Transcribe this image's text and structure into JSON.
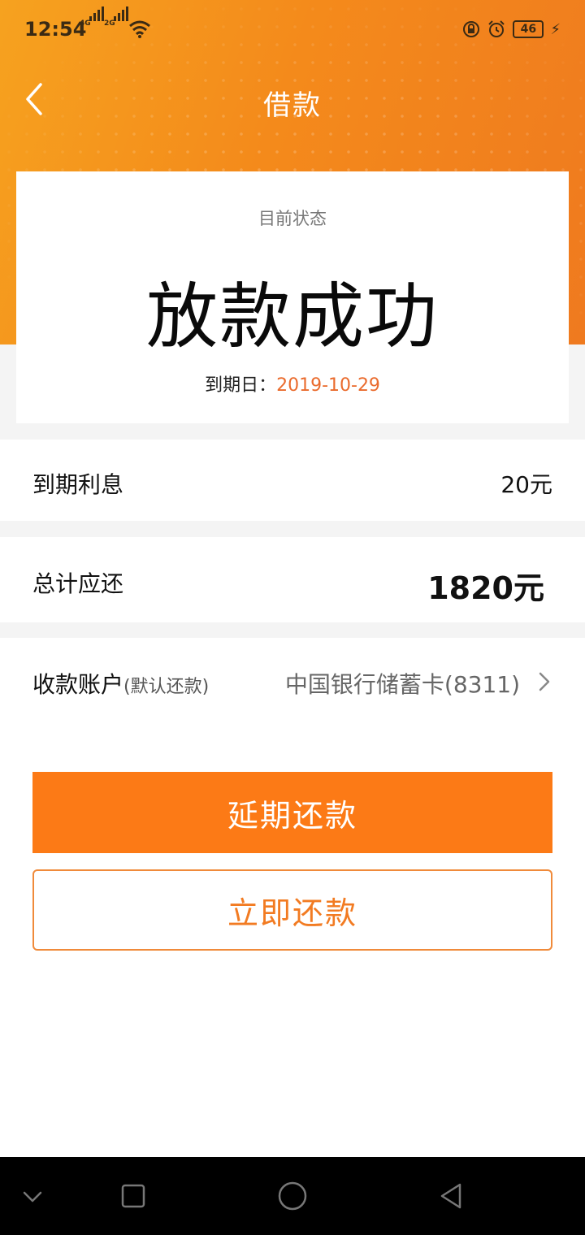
{
  "status_bar": {
    "time": "12:54",
    "sim1_label": "4G",
    "sim2_label": "2G",
    "battery": "46"
  },
  "header": {
    "title": "借款",
    "back_icon": "chevron-left-icon"
  },
  "status_card": {
    "label": "目前状态",
    "status": "放款成功",
    "due_label": "到期日：",
    "due_date": "2019-10-29"
  },
  "rows": {
    "interest_label": "到期利息",
    "interest_value": "20元",
    "total_label": "总计应还",
    "total_value": "1820元",
    "account_label": "收款账户",
    "account_sub": "(默认还款)",
    "account_value": "中国银行储蓄卡(8311)"
  },
  "buttons": {
    "extend": "延期还款",
    "repay_now": "立即还款"
  },
  "colors": {
    "brand_orange": "#fc7a16",
    "accent_red": "#ea6b2d"
  }
}
